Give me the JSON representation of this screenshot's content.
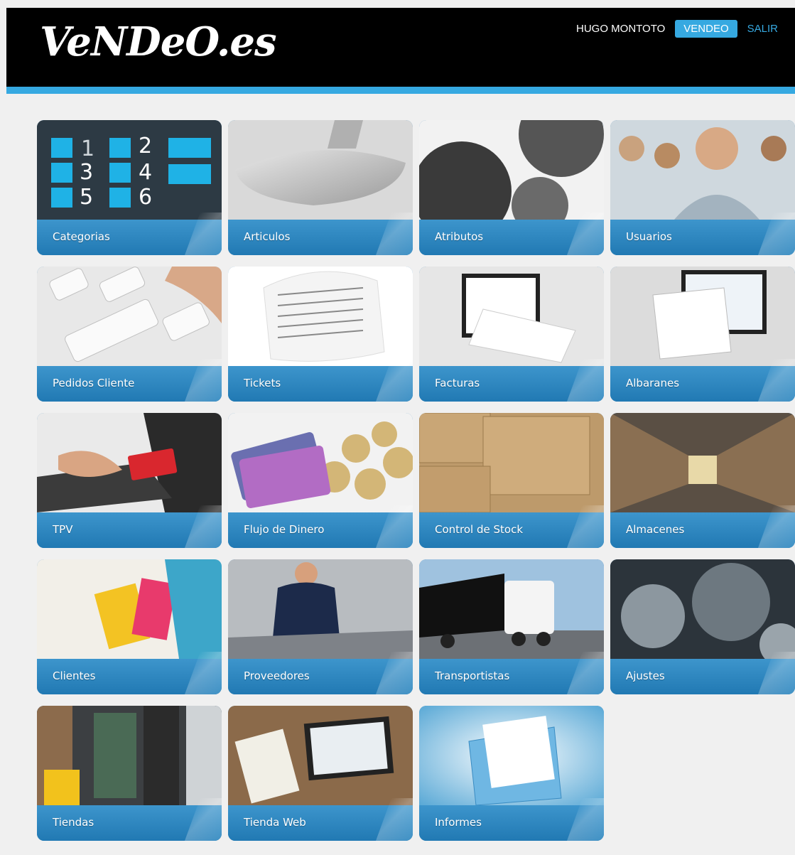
{
  "header": {
    "logo": "VeNDeO.es",
    "user": "HUGO MONTOTO",
    "active_button": "VENDEO",
    "logout": "SALIR"
  },
  "colors": {
    "accent": "#36a9e1",
    "tile_bar": "#2179b3",
    "header_bg": "#000000",
    "page_bg": "#f0f0f0"
  },
  "tiles": [
    {
      "label": "Categorias",
      "icon": "keypad-icon"
    },
    {
      "label": "Articulos",
      "icon": "spoon-icon"
    },
    {
      "label": "Atributos",
      "icon": "gears-icon"
    },
    {
      "label": "Usuarios",
      "icon": "people-icon"
    },
    {
      "label": "Pedidos Cliente",
      "icon": "keyboard-icon"
    },
    {
      "label": "Tickets",
      "icon": "receipt-icon"
    },
    {
      "label": "Facturas",
      "icon": "monitor-invoice-icon"
    },
    {
      "label": "Albaranes",
      "icon": "delivery-note-icon"
    },
    {
      "label": "TPV",
      "icon": "card-payment-icon"
    },
    {
      "label": "Flujo de Dinero",
      "icon": "coins-icon"
    },
    {
      "label": "Control de Stock",
      "icon": "boxes-icon"
    },
    {
      "label": "Almacenes",
      "icon": "warehouse-icon"
    },
    {
      "label": "Clientes",
      "icon": "shopping-bags-icon"
    },
    {
      "label": "Proveedores",
      "icon": "worker-icon"
    },
    {
      "label": "Transportistas",
      "icon": "truck-icon"
    },
    {
      "label": "Ajustes",
      "icon": "settings-gears-icon"
    },
    {
      "label": "Tiendas",
      "icon": "store-icon"
    },
    {
      "label": "Tienda Web",
      "icon": "laptop-icon"
    },
    {
      "label": "Informes",
      "icon": "folder-icon"
    }
  ]
}
